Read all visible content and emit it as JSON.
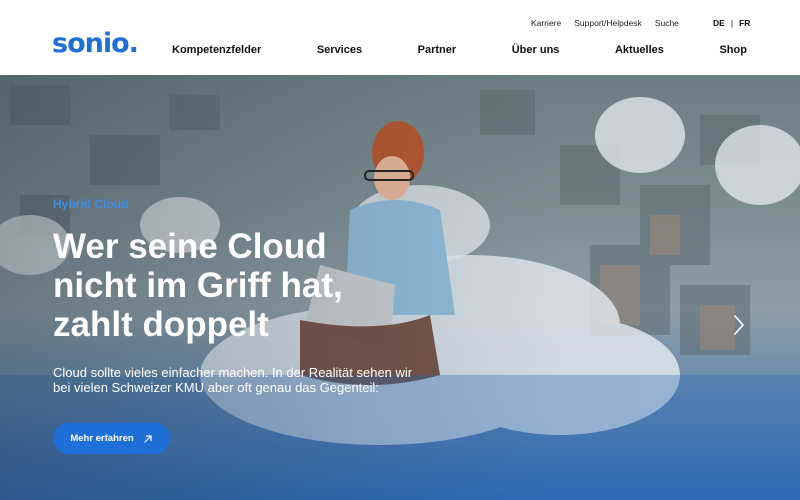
{
  "brand": {
    "logo_text": "sonio."
  },
  "utility_nav": [
    "Karriere",
    "Support/Helpdesk",
    "Suche"
  ],
  "languages": {
    "de": "DE",
    "separator": "|",
    "fr": "FR"
  },
  "main_nav": [
    "Kompetenzfelder",
    "Services",
    "Partner",
    "Über uns",
    "Aktuelles",
    "Shop"
  ],
  "hero": {
    "eyebrow": "Hybrid Cloud",
    "headline_lines": [
      "Wer seine Cloud",
      "nicht im Griff hat,",
      "zahlt doppelt"
    ],
    "intro": "Cloud sollte vieles einfacher machen. In der Realität sehen wir bei vielen Schweizer KMU aber oft genau das Gegenteil:",
    "cta_label": "Mehr erfahren",
    "cta_icon": "arrow-up-right-icon",
    "next_icon": "chevron-right-icon"
  },
  "colors": {
    "brand_blue": "#1f6fd8",
    "eyebrow_blue": "#3a8ee6",
    "text_dark": "#111111"
  }
}
